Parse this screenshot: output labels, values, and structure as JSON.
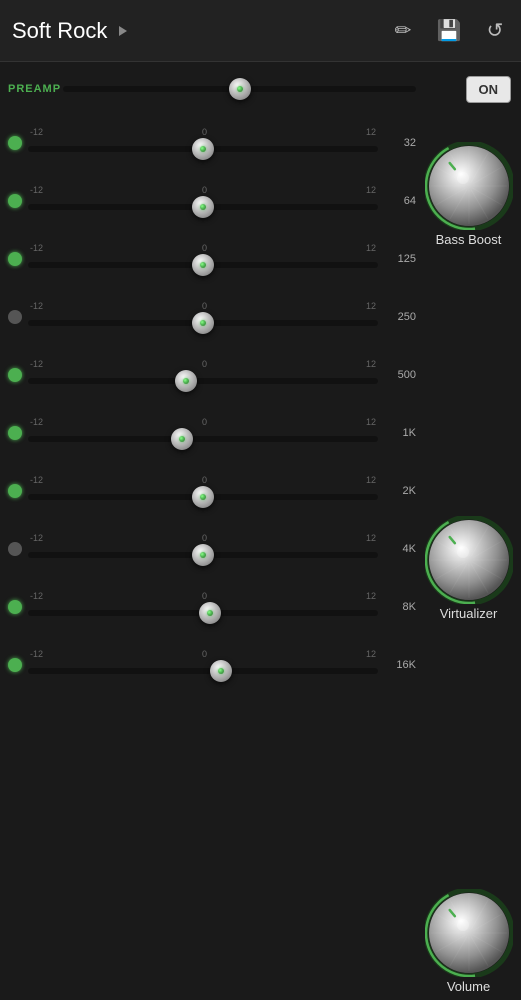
{
  "header": {
    "title": "Soft Rock",
    "on_label": "ON"
  },
  "preamp": {
    "label": "PREAMP",
    "thumb_position": 0.5
  },
  "bands": [
    {
      "freq": "32",
      "thumb_pct": 0.5,
      "active": true
    },
    {
      "freq": "64",
      "thumb_pct": 0.5,
      "active": true
    },
    {
      "freq": "125",
      "thumb_pct": 0.5,
      "active": true
    },
    {
      "freq": "250",
      "thumb_pct": 0.5,
      "active": false
    },
    {
      "freq": "500",
      "thumb_pct": 0.45,
      "active": true
    },
    {
      "freq": "1K",
      "thumb_pct": 0.44,
      "active": true
    },
    {
      "freq": "2K",
      "thumb_pct": 0.5,
      "active": true
    },
    {
      "freq": "4K",
      "thumb_pct": 0.5,
      "active": false
    },
    {
      "freq": "8K",
      "thumb_pct": 0.52,
      "active": true
    },
    {
      "freq": "16K",
      "thumb_pct": 0.55,
      "active": true
    }
  ],
  "ticks": {
    "left": "-12",
    "center": "0",
    "right": "12"
  },
  "knobs": [
    {
      "id": "bass-boost",
      "label": "Bass Boost",
      "rotation": -40,
      "slot_start_band": 0,
      "slot_end_band": 2
    },
    {
      "id": "virtualizer",
      "label": "Virtualizer",
      "rotation": -40,
      "slot_start_band": 4,
      "slot_end_band": 6
    },
    {
      "id": "volume",
      "label": "Volume",
      "rotation": -40,
      "slot_start_band": 7,
      "slot_end_band": 9
    }
  ],
  "icons": {
    "pencil": "✏",
    "save": "💾",
    "reset": "↺"
  }
}
